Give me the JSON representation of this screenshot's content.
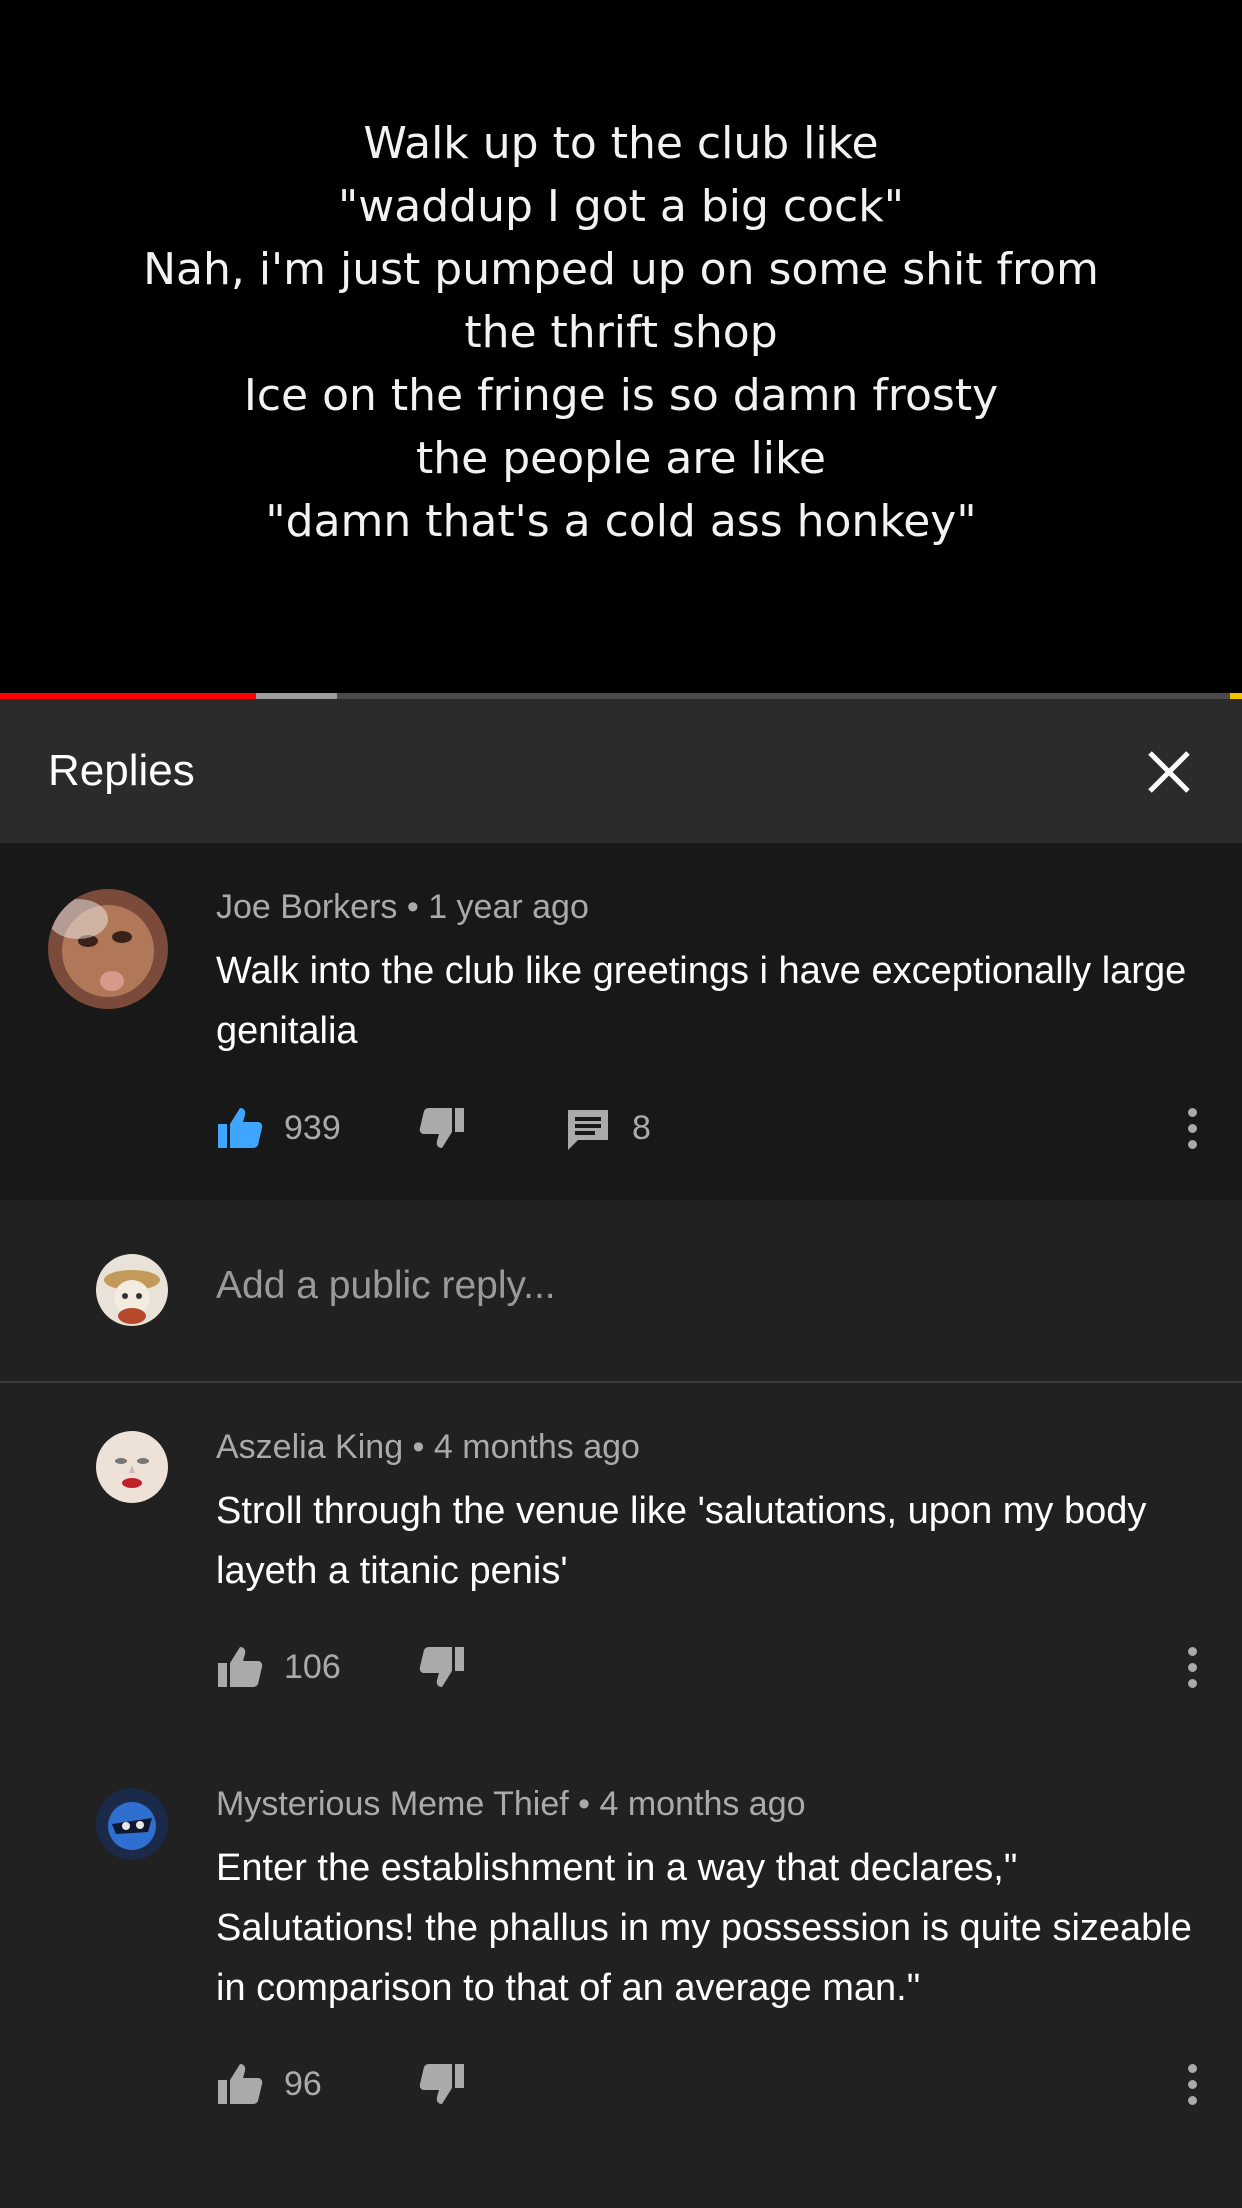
{
  "video": {
    "lyrics": [
      "Walk up to the club like",
      "\"waddup I got a big cock\"",
      "Nah, i'm just pumped up on some shit from",
      "the thrift shop",
      "Ice on the fringe is so damn frosty",
      "the people are like",
      "\"damn that's a cold ass honkey\""
    ],
    "progress_played_fraction": 0.206,
    "progress_buffered_fraction": 0.271
  },
  "header": {
    "title": "Replies",
    "close_icon": "close-icon"
  },
  "parent": {
    "author": "Joe Borkers",
    "time": "1 year ago",
    "text": "Walk into the club like greetings i have exceptionally large genitalia",
    "likes": "939",
    "replies": "8",
    "liked": true
  },
  "reply_box": {
    "placeholder": "Add a public reply..."
  },
  "replies": [
    {
      "author": "Aszelia King",
      "time": "4 months ago",
      "text": "Stroll through the venue like 'salutations, upon my body layeth a titanic penis'",
      "likes": "106"
    },
    {
      "author": "Mysterious Meme Thief",
      "time": "4 months ago",
      "text": "Enter the establishment in a way that declares,\" Salutations! the phallus in my possession is quite sizeable in comparison to that of an average man.\"",
      "likes": "96"
    }
  ],
  "colors": {
    "like_active": "#3ea6ff",
    "progress_played": "#ff0000",
    "background": "#212121"
  }
}
